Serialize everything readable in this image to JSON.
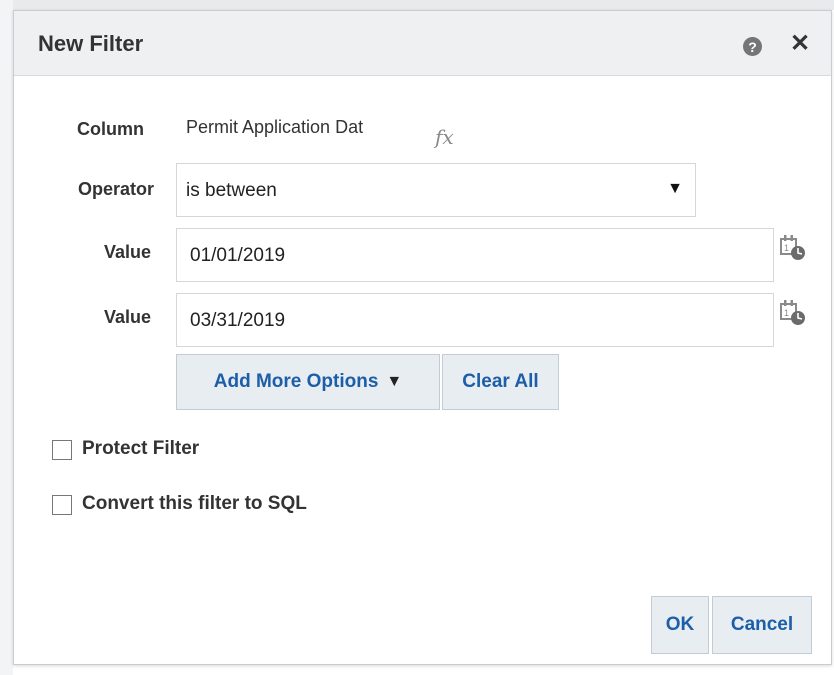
{
  "dialog": {
    "title": "New Filter",
    "help_icon": "question-circle-icon",
    "help_glyph": "?",
    "close_icon": "close-icon",
    "close_glyph": "✕"
  },
  "form": {
    "column_label": "Column",
    "column_value": "Permit Application Dat",
    "formula_icon": "fx",
    "operator_label": "Operator",
    "operator_value": "is between",
    "operator_caret": "▼",
    "value1_label": "Value",
    "value1": "01/01/2019",
    "value2_label": "Value",
    "value2": "03/31/2019",
    "calendar_icon": "calendar-clock-icon"
  },
  "buttons": {
    "add_more_options": "Add More Options",
    "add_more_caret": "▼",
    "clear_all": "Clear All",
    "ok": "OK",
    "cancel": "Cancel"
  },
  "options": {
    "protect_filter": "Protect Filter",
    "convert_sql": "Convert this filter to SQL"
  },
  "colors": {
    "button_text": "#1d5ea8",
    "header_bg": "#eef0f1"
  }
}
